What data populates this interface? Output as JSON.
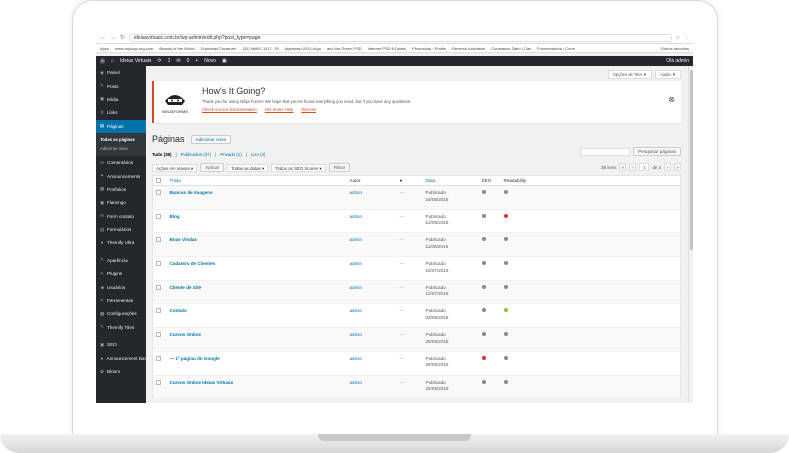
{
  "browser": {
    "url": "ideiasvirtuais.com.br/wp-admin/edit.php?post_type=page",
    "bookmarks": [
      "Apps",
      "www.mytogo.org.com",
      "Brands of the World",
      "Download Treasure!",
      "(31) 96897-1117 - Rl",
      "Agendas>2011>Ago",
      "aux the Green PSD",
      "Internet PSD 6 Downl",
      "Photoshop › Profile",
      "Reverse Activation",
      "Constance Zahn | Cas",
      "Fornecedores › Cone"
    ],
    "bookmarks_right": "Outros favoritos"
  },
  "adminbar": {
    "site": "Ideias Virtuais",
    "updates": "1",
    "comments": "0",
    "new": "Novo",
    "greeting": "Olá admin"
  },
  "sidebar": {
    "items": [
      {
        "label": "Painel",
        "icon": "dashboard-icon",
        "glyph": "◉"
      },
      {
        "label": "Posts",
        "icon": "pin-icon",
        "glyph": "✎"
      },
      {
        "label": "Mídia",
        "icon": "media-icon",
        "glyph": "▣"
      },
      {
        "label": "Links",
        "icon": "link-icon",
        "glyph": "⚲"
      },
      {
        "label": "Páginas",
        "icon": "pages-icon",
        "glyph": "▤"
      }
    ],
    "sub": [
      "Todas as páginas",
      "Adicionar nova"
    ],
    "items2": [
      {
        "label": "Comentários",
        "icon": "comment-icon",
        "glyph": "✉"
      },
      {
        "label": "Announcements",
        "icon": "megaphone-icon",
        "glyph": "✦"
      },
      {
        "label": "Portfolios",
        "icon": "portfolio-icon",
        "glyph": "▦"
      },
      {
        "label": "Flamingo",
        "icon": "flamingo-icon",
        "glyph": "▣"
      },
      {
        "label": "Form contato",
        "icon": "mail-icon",
        "glyph": "✉"
      },
      {
        "label": "Formulários",
        "icon": "form-icon",
        "glyph": "▤"
      },
      {
        "label": "Themify Ultra",
        "icon": "themify-icon",
        "glyph": "●"
      }
    ],
    "items3": [
      {
        "label": "Aparência",
        "icon": "brush-icon",
        "glyph": "✎"
      },
      {
        "label": "Plugins",
        "icon": "plugin-icon",
        "glyph": "✎"
      },
      {
        "label": "Usuários",
        "icon": "users-icon",
        "glyph": "☻"
      },
      {
        "label": "Ferramentas",
        "icon": "tools-icon",
        "glyph": "✎"
      },
      {
        "label": "Configurações",
        "icon": "settings-icon",
        "glyph": "▦"
      },
      {
        "label": "Themify Tiles",
        "icon": "tiles-icon",
        "glyph": "✎"
      }
    ],
    "items4": [
      {
        "label": "SEO",
        "icon": "seo-icon",
        "glyph": "▣"
      },
      {
        "label": "Announcement Bar",
        "icon": "bar-icon",
        "glyph": "●"
      },
      {
        "label": "Bloom",
        "icon": "bloom-icon",
        "glyph": "✿"
      }
    ]
  },
  "screen_meta": {
    "options": "Opções de Tela ▼",
    "help": "Ajuda ▼"
  },
  "notice": {
    "title": "How's It Going?",
    "logo_text": "NINJAFORMS",
    "text": "Thank you for using Ninja Forms! We hope that you've found everything you need, but if you have any questions:",
    "links": [
      "Check out our documentation",
      "Get Some Help",
      "Dismiss"
    ]
  },
  "page": {
    "title": "Páginas",
    "add_new": "Adicionar nova",
    "search_btn": "Pesquisar páginas",
    "filters": [
      "Tudo (38)",
      "Publicados (37)",
      "Privado (1)",
      "Lixo (2)"
    ],
    "bulk": "Ações em massa",
    "apply": "Aplicar",
    "dates": "Todas as datas",
    "seo": "Todos os SEO Scores",
    "filter": "Filtrar",
    "items_count": "38 itens",
    "page_num": "1",
    "page_of": "de 2"
  },
  "table": {
    "headers": {
      "title": "Título",
      "author": "Autor",
      "date": "Data",
      "seo": "SEO",
      "readability": "Readability"
    },
    "rows": [
      {
        "title": "Bancos de Imagens",
        "author": "admin",
        "comments": "—",
        "status": "Publicado",
        "date": "24/05/2015",
        "seo": "#888888",
        "read": "#888888"
      },
      {
        "title": "Blog",
        "author": "admin",
        "comments": "—",
        "status": "Publicado",
        "date": "12/08/2016",
        "seo": "#888888",
        "read": "#dc3232"
      },
      {
        "title": "Boas Vindas",
        "author": "admin",
        "comments": "—",
        "status": "Publicado",
        "date": "11/06/2016",
        "seo": "#888888",
        "read": "#888888"
      },
      {
        "title": "Cadastro de Clientes",
        "author": "admin",
        "comments": "—",
        "status": "Publicado",
        "date": "15/07/2016",
        "seo": "#888888",
        "read": "#888888"
      },
      {
        "title": "Cliente de Site",
        "author": "admin",
        "comments": "—",
        "status": "Publicado",
        "date": "12/07/2016",
        "seo": "#888888",
        "read": "#888888"
      },
      {
        "title": "Contato",
        "author": "admin",
        "comments": "—",
        "status": "Publicado",
        "date": "03/08/2016",
        "seo": "#888888",
        "read": "#7ad03a"
      },
      {
        "title": "Cursos Online",
        "author": "admin",
        "comments": "—",
        "status": "Publicado",
        "date": "25/05/2015",
        "seo": "#888888",
        "read": "#888888"
      },
      {
        "title": "— 1ª página do Google",
        "author": "admin",
        "comments": "—",
        "status": "Publicado",
        "date": "26/05/2016",
        "seo": "#dc3232",
        "read": "#888888"
      },
      {
        "title": "Cursos Online Ideias Virtuais",
        "author": "admin",
        "comments": "—",
        "status": "Publicado",
        "date": "25/05/2015",
        "seo": "#888888",
        "read": "#888888"
      }
    ]
  }
}
